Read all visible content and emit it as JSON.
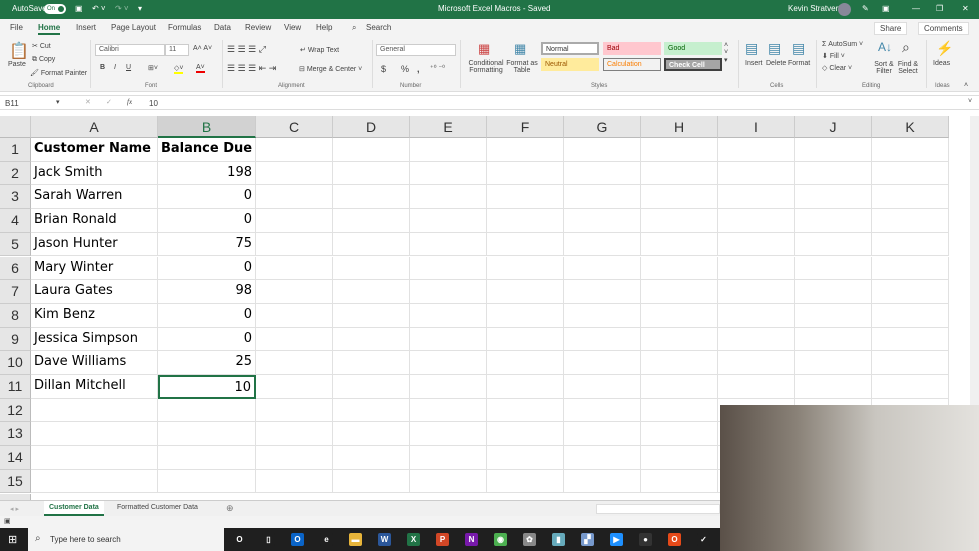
{
  "titlebar": {
    "autosave": "AutoSave",
    "autosave_state": "On",
    "title": "Microsoft Excel Macros  -  Saved",
    "user": "Kevin Stratvert",
    "color": "#217346"
  },
  "tabs": [
    {
      "label": "File"
    },
    {
      "label": "Home",
      "active": true
    },
    {
      "label": "Insert"
    },
    {
      "label": "Page Layout"
    },
    {
      "label": "Formulas"
    },
    {
      "label": "Data"
    },
    {
      "label": "Review"
    },
    {
      "label": "View"
    },
    {
      "label": "Help"
    }
  ],
  "search": "Search",
  "share": "Share",
  "comments": "Comments",
  "ribbon": {
    "clipboard": {
      "paste": "Paste",
      "cut": "Cut",
      "copy": "Copy",
      "format_painter": "Format Painter",
      "group": "Clipboard"
    },
    "font": {
      "name": "Calibri",
      "size": "11",
      "bold": "B",
      "italic": "I",
      "underline": "U",
      "group": "Font"
    },
    "alignment": {
      "wrap": "Wrap Text",
      "merge": "Merge & Center",
      "group": "Alignment"
    },
    "number": {
      "format": "General",
      "currency": "$",
      "percent": "%",
      "comma": ",",
      "group": "Number"
    },
    "styles": {
      "conditional": "Conditional Formatting",
      "format_table": "Format as Table",
      "normal": "Normal",
      "bad": "Bad",
      "good": "Good",
      "neutral": "Neutral",
      "calculation": "Calculation",
      "check_cell": "Check Cell",
      "group": "Styles"
    },
    "cells": {
      "insert": "Insert",
      "delete": "Delete",
      "format": "Format",
      "group": "Cells"
    },
    "editing": {
      "autosum": "AutoSum",
      "fill": "Fill",
      "clear": "Clear",
      "sort": "Sort & Filter",
      "find": "Find & Select",
      "group": "Editing"
    },
    "ideas": {
      "label": "Ideas",
      "group": "Ideas"
    }
  },
  "formula_bar": {
    "name_box": "B11",
    "fx": "fx",
    "value": "10"
  },
  "columns": [
    "A",
    "B",
    "C",
    "D",
    "E",
    "F",
    "G",
    "H",
    "I",
    "J",
    "K"
  ],
  "selected_column": "B",
  "rows": [
    [
      "Customer Name",
      "Balance Due"
    ],
    [
      "Jack Smith",
      "198"
    ],
    [
      "Sarah Warren",
      "0"
    ],
    [
      "Brian Ronald",
      "0"
    ],
    [
      "Jason Hunter",
      "75"
    ],
    [
      "Mary Winter",
      "0"
    ],
    [
      "Laura Gates",
      "98"
    ],
    [
      "Kim Benz",
      "0"
    ],
    [
      "Jessica Simpson",
      "0"
    ],
    [
      "Dave Williams",
      "25"
    ],
    [
      "Dillan Mitchell",
      "10"
    ],
    [
      "",
      ""
    ],
    [
      "",
      ""
    ],
    [
      "",
      ""
    ],
    [
      "",
      ""
    ]
  ],
  "row_numbers": [
    "1",
    "2",
    "3",
    "4",
    "5",
    "6",
    "7",
    "8",
    "9",
    "10",
    "11",
    "12",
    "13",
    "14",
    "15"
  ],
  "active_cell": "B11",
  "sheets": [
    {
      "label": "Customer Data",
      "active": true
    },
    {
      "label": "Formatted Customer Data"
    }
  ],
  "taskbar": {
    "search_placeholder": "Type here to search",
    "apps": [
      "cortana",
      "task-view",
      "outlook",
      "edge",
      "file-explorer",
      "word",
      "excel",
      "powerpoint",
      "onenote",
      "chrome",
      "paint",
      "notepad",
      "snipping",
      "media",
      "obs",
      "office",
      "steam"
    ]
  }
}
